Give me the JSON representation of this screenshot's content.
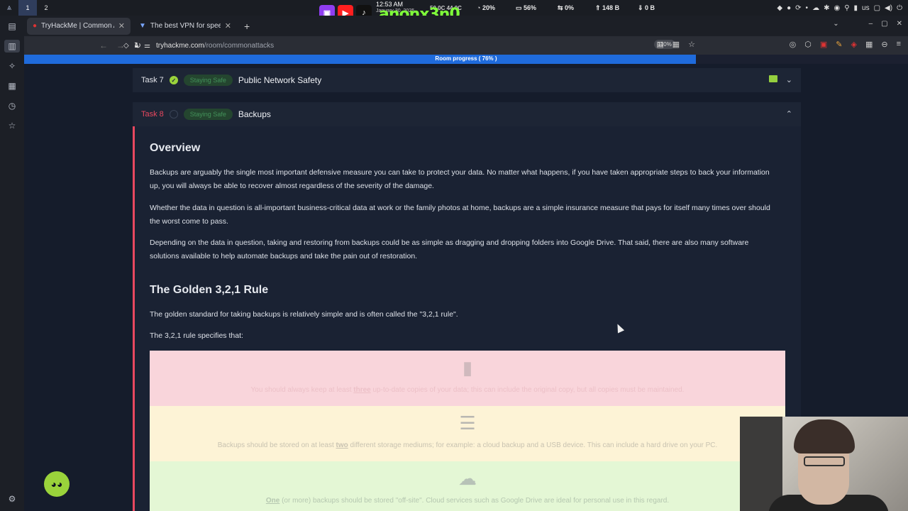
{
  "os": {
    "workspaces": [
      "1",
      "2"
    ],
    "time": "12:53 AM",
    "date": "January 30, 2025",
    "temps": "50.0C  44.0C",
    "stream_name": "anonx3n0",
    "stats": [
      "20%",
      "56%",
      "0%",
      "148 B",
      "0 B"
    ],
    "layout": "us"
  },
  "browser": {
    "tabs": [
      {
        "title": "TryHackMe | Common Att",
        "active": true
      },
      {
        "title": "The best VPN for speed a",
        "active": false
      }
    ],
    "url_host": "tryhackme.com",
    "url_path": "/room/commonattacks",
    "zoom": "110%"
  },
  "progress": {
    "label": "Room progress ( 76% )",
    "value": 0.76
  },
  "tasks": [
    {
      "num": "Task 7",
      "tag": "Staying Safe",
      "title": "Public Network Safety",
      "done": true
    },
    {
      "num": "Task 8",
      "tag": "Staying Safe",
      "title": "Backups",
      "done": false
    }
  ],
  "content": {
    "overview_heading": "Overview",
    "p1": "Backups are arguably the single most important defensive measure you can take to protect your data. No matter what happens, if you have taken appropriate steps to back your information up, you will always be able to recover almost regardless of the severity of the damage.",
    "p2": "Whether the data in question is all-important business-critical data at work or the family photos at home, backups are a simple insurance measure that pays for itself many times over should the worst come to pass.",
    "p3": "Depending on the data in question, taking and restoring from backups could be as simple as dragging and dropping folders into Google Drive. That said, there are also many software solutions available to help automate backups and take the pain out of restoration.",
    "golden_heading": "The Golden 3,2,1 Rule",
    "p4": "The golden standard for taking backups is relatively simple and is often called the \"3,2,1 rule\".",
    "p5": "The 3,2,1 rule specifies that:",
    "rules": [
      {
        "pre": "You should always keep at least ",
        "bold": "three",
        "post": " up-to-date copies of your data; this can include the original copy, but all copies must be maintained.",
        "bg": "#f9d5db",
        "fg": "#ecc0c7",
        "icon": "file-video-icon"
      },
      {
        "pre": "Backups should be stored on at least ",
        "bold": "two",
        "post": " different storage mediums; for example: a cloud backup and a USB device. This can include a hard drive on your PC.",
        "bg": "#fdf3d6",
        "fg": "#c9c3b1",
        "icon": "server-icon"
      },
      {
        "pre": "",
        "bold": "One",
        "post": " (or more) backups should be stored \"off-site\". Cloud services such as Google Drive are ideal for personal use in this regard.",
        "bg": "#e4f7d5",
        "fg": "#b5c7b0",
        "icon": "cloud-icon"
      }
    ]
  }
}
